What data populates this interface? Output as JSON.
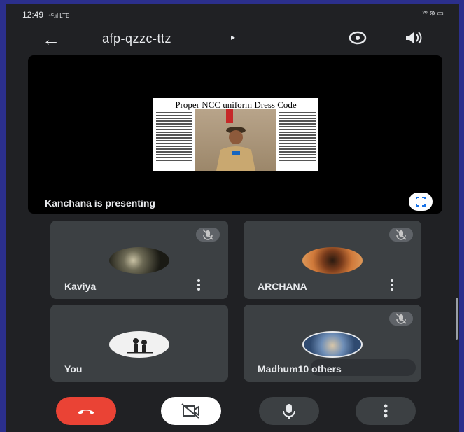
{
  "status_bar": {
    "time": "12:49",
    "signal": "⁴ᴳ.ıl LTE",
    "right_icons": "ᵛᵒ ⊛ ▭"
  },
  "header": {
    "back_icon": "arrow-left-icon",
    "meeting_code": "afp-qzzc-ttz",
    "caret": "▸"
  },
  "presentation": {
    "slide_title": "Proper NCC uniform Dress Code",
    "presenter_label": "Kanchana is presenting"
  },
  "participants": [
    {
      "name": "Kaviya",
      "muted": true
    },
    {
      "name": "ARCHANA",
      "muted": true
    },
    {
      "name": "You",
      "muted": false
    },
    {
      "name": "Madhum",
      "muted": true,
      "others_label": "10 others"
    }
  ],
  "colors": {
    "background": "#2b2f8c",
    "surface": "#202124",
    "tile": "#3c4043",
    "end_call": "#ea4335",
    "control_dark": "#3c4043",
    "control_light": "#ffffff"
  }
}
